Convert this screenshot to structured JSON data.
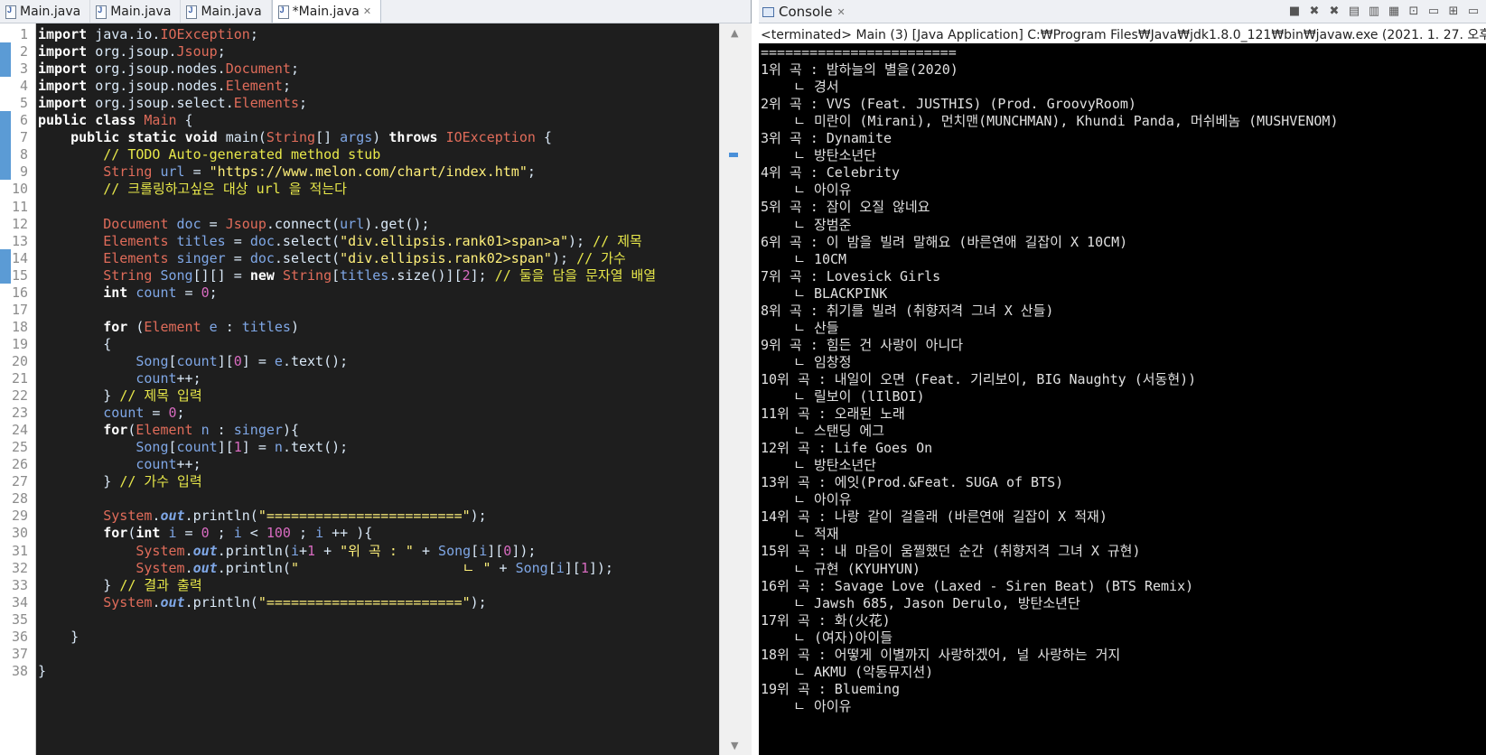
{
  "editor": {
    "tabs": [
      {
        "label": "Main.java",
        "active": false
      },
      {
        "label": "Main.java",
        "active": false
      },
      {
        "label": "Main.java",
        "active": false
      },
      {
        "label": "*Main.java",
        "active": true
      }
    ],
    "lines": [
      "import java.io.IOException;",
      "import org.jsoup.Jsoup;",
      "import org.jsoup.nodes.Document;",
      "import org.jsoup.nodes.Element;",
      "import org.jsoup.select.Elements;",
      "public class Main {",
      "    public static void main(String[] args) throws IOException {",
      "        // TODO Auto-generated method stub",
      "        String url = \"https://www.melon.com/chart/index.htm\";",
      "        // 크롤링하고싶은 대상 url 을 적는다",
      "",
      "        Document doc = Jsoup.connect(url).get();",
      "        Elements titles = doc.select(\"div.ellipsis.rank01>span>a\"); // 제목",
      "        Elements singer = doc.select(\"div.ellipsis.rank02>span\"); // 가수",
      "        String Song[][] = new String[titles.size()][2]; // 둘을 담을 문자열 배열",
      "        int count = 0;",
      "",
      "        for (Element e : titles)",
      "        {",
      "            Song[count][0] = e.text();",
      "            count++;",
      "        } // 제목 입력",
      "        count = 0;",
      "        for(Element n : singer){",
      "            Song[count][1] = n.text();",
      "            count++;",
      "        } // 가수 입력",
      "",
      "        System.out.println(\"========================\");",
      "        for(int i = 0 ; i < 100 ; i ++ ){",
      "            System.out.println(i+1 + \"위 곡 : \" + Song[i][0]);",
      "            System.out.println(\"                    ㄴ \" + Song[i][1]);",
      "        } // 결과 출력",
      "        System.out.println(\"========================\");",
      "",
      "    }",
      "",
      "}"
    ]
  },
  "console": {
    "tab_label": "Console",
    "header": "<terminated> Main (3) [Java Application] C:₩Program Files₩Java₩jdk1.8.0_121₩bin₩javaw.exe (2021. 1. 27. 오후 8:28:5",
    "separator": "========================",
    "entries": [
      {
        "rank": "1위 곡 : ",
        "title": "밤하늘의 별을(2020)",
        "artist": "경서"
      },
      {
        "rank": "2위 곡 : ",
        "title": "VVS (Feat. JUSTHIS) (Prod. GroovyRoom)",
        "artist": "미란이 (Mirani), 먼치맨(MUNCHMAN), Khundi Panda, 머쉬베놈 (MUSHVENOM)"
      },
      {
        "rank": "3위 곡 : ",
        "title": "Dynamite",
        "artist": "방탄소년단"
      },
      {
        "rank": "4위 곡 : ",
        "title": "Celebrity",
        "artist": "아이유"
      },
      {
        "rank": "5위 곡 : ",
        "title": "잠이 오질 않네요",
        "artist": "장범준"
      },
      {
        "rank": "6위 곡 : ",
        "title": "이 밤을 빌려 말해요 (바른연애 길잡이 X 10CM)",
        "artist": "10CM"
      },
      {
        "rank": "7위 곡 : ",
        "title": "Lovesick Girls",
        "artist": "BLACKPINK"
      },
      {
        "rank": "8위 곡 : ",
        "title": "취기를 빌려 (취향저격 그녀 X 산들)",
        "artist": "산들"
      },
      {
        "rank": "9위 곡 : ",
        "title": "힘든 건 사랑이 아니다",
        "artist": "임창정"
      },
      {
        "rank": "10위 곡 : ",
        "title": "내일이 오면 (Feat. 기리보이, BIG Naughty (서동현))",
        "artist": "릴보이 (lIlBOI)"
      },
      {
        "rank": "11위 곡 : ",
        "title": "오래된 노래",
        "artist": "스탠딩 에그"
      },
      {
        "rank": "12위 곡 : ",
        "title": "Life Goes On",
        "artist": "방탄소년단"
      },
      {
        "rank": "13위 곡 : ",
        "title": "에잇(Prod.&Feat. SUGA of BTS)",
        "artist": "아이유"
      },
      {
        "rank": "14위 곡 : ",
        "title": "나랑 같이 걸을래 (바른연애 길잡이 X 적재)",
        "artist": "적재"
      },
      {
        "rank": "15위 곡 : ",
        "title": "내 마음이 움찔했던 순간 (취향저격 그녀 X 규현)",
        "artist": "규현 (KYUHYUN)"
      },
      {
        "rank": "16위 곡 : ",
        "title": "Savage Love (Laxed - Siren Beat) (BTS Remix)",
        "artist": "Jawsh 685, Jason Derulo, 방탄소년단"
      },
      {
        "rank": "17위 곡 : ",
        "title": "화(火花)",
        "artist": "(여자)아이들"
      },
      {
        "rank": "18위 곡 : ",
        "title": "어떻게 이별까지 사랑하겠어, 널 사랑하는 거지",
        "artist": "AKMU (악동뮤지션)"
      },
      {
        "rank": "19위 곡 : ",
        "title": "Blueming",
        "artist": "아이유"
      }
    ],
    "artist_prefix": "    ㄴ "
  },
  "colors": {
    "editor_bg": "#1e1e1e",
    "keyword": "#ffffff",
    "string": "#fff07a",
    "comment": "#e8e84a",
    "type": "#e06c5a",
    "field": "#7fa7e6",
    "number": "#d86bc0",
    "console_bg": "#000000",
    "gutter_marker": "#5b9bd5"
  }
}
